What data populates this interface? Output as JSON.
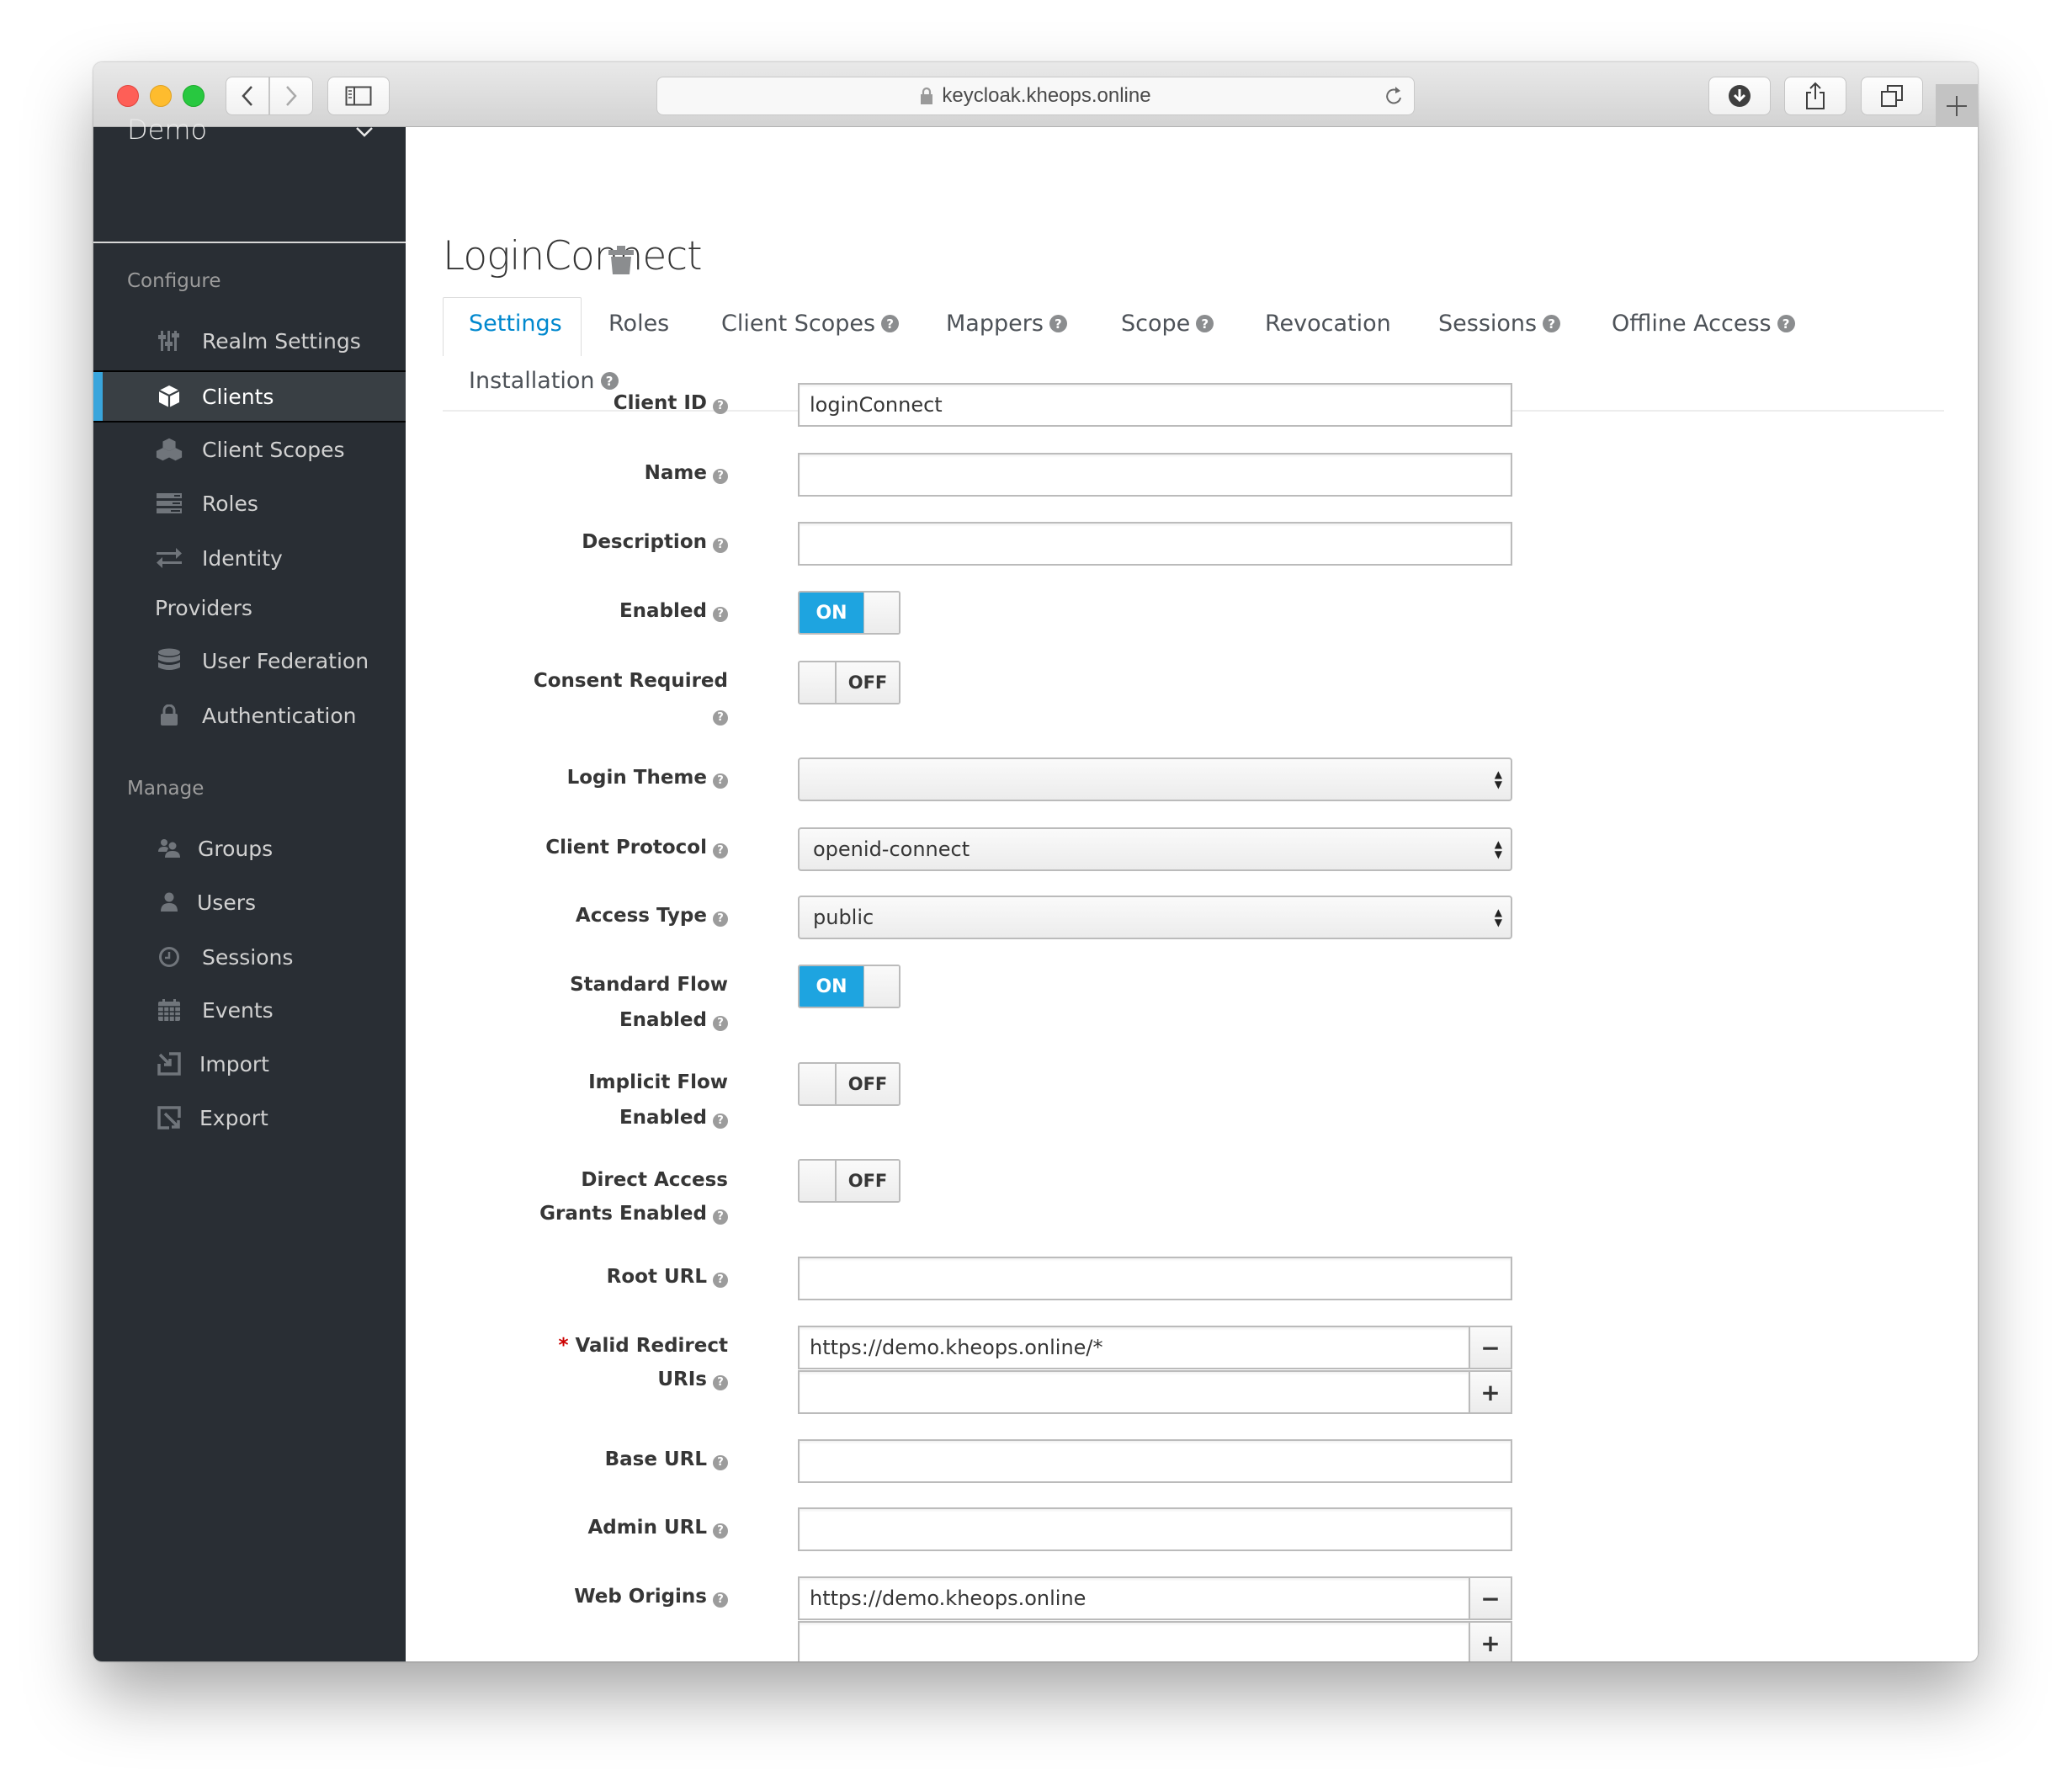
{
  "browser": {
    "url": "keycloak.kheops.online",
    "traffic_lights": {
      "close": "#fe5f57",
      "minimize": "#febc2e",
      "zoom": "#28c840"
    },
    "icons": [
      "back-icon",
      "forward-icon",
      "sidebar-toggle-icon",
      "lock-icon",
      "reload-icon",
      "download-icon",
      "share-icon",
      "tabs-overview-icon",
      "new-tab-icon"
    ]
  },
  "sidebar": {
    "realm": "Demo",
    "sections": [
      {
        "label": "Configure"
      },
      {
        "label": "Manage"
      }
    ],
    "items": [
      {
        "label": "Realm Settings",
        "icon": "sliders-icon"
      },
      {
        "label": "Clients",
        "icon": "cube-icon",
        "active": true
      },
      {
        "label": "Client Scopes",
        "icon": "cubes-icon"
      },
      {
        "label": "Roles",
        "icon": "list-icon"
      },
      {
        "label": "Identity",
        "icon": "exchange-icon"
      },
      {
        "label": "Providers"
      },
      {
        "label": "User Federation",
        "icon": "database-icon"
      },
      {
        "label": "Authentication",
        "icon": "lock-icon"
      },
      {
        "label": "Groups",
        "icon": "users-icon"
      },
      {
        "label": "Users",
        "icon": "user-icon"
      },
      {
        "label": "Sessions",
        "icon": "clock-icon"
      },
      {
        "label": "Events",
        "icon": "calendar-icon"
      },
      {
        "label": "Import",
        "icon": "import-icon"
      },
      {
        "label": "Export",
        "icon": "export-icon"
      }
    ],
    "accent": "#39a5dc"
  },
  "main": {
    "title": "LoginConnect",
    "tabs": [
      {
        "label": "Settings",
        "active": true,
        "help": false
      },
      {
        "label": "Roles",
        "help": false
      },
      {
        "label": "Client Scopes",
        "help": true
      },
      {
        "label": "Mappers",
        "help": true
      },
      {
        "label": "Scope",
        "help": true
      },
      {
        "label": "Revocation",
        "help": false
      },
      {
        "label": "Sessions",
        "help": true
      },
      {
        "label": "Offline Access",
        "help": true
      },
      {
        "label": "Installation",
        "help": true
      }
    ],
    "help_glyph": "?",
    "form": {
      "client_id": {
        "label": "Client ID",
        "value": "loginConnect"
      },
      "name": {
        "label": "Name",
        "value": ""
      },
      "description": {
        "label": "Description",
        "value": ""
      },
      "enabled": {
        "label": "Enabled",
        "state": "ON"
      },
      "consent_required": {
        "label": "Consent Required",
        "state": "OFF"
      },
      "login_theme": {
        "label": "Login Theme",
        "value": ""
      },
      "client_protocol": {
        "label": "Client Protocol",
        "value": "openid-connect"
      },
      "access_type": {
        "label": "Access Type",
        "value": "public"
      },
      "standard_flow": {
        "label_line1": "Standard Flow",
        "label_line2": "Enabled",
        "state": "ON"
      },
      "implicit_flow": {
        "label_line1": "Implicit Flow",
        "label_line2": "Enabled",
        "state": "OFF"
      },
      "direct_access": {
        "label_line1": "Direct Access",
        "label_line2": "Grants Enabled",
        "state": "OFF"
      },
      "root_url": {
        "label": "Root URL",
        "value": ""
      },
      "valid_redirect_uris": {
        "required_mark": "*",
        "label_line1": "Valid Redirect",
        "label_line2": "URIs",
        "values": [
          "https://demo.kheops.online/*",
          ""
        ]
      },
      "base_url": {
        "label": "Base URL",
        "value": ""
      },
      "admin_url": {
        "label": "Admin URL",
        "value": ""
      },
      "web_origins": {
        "label": "Web Origins",
        "values": [
          "https://demo.kheops.online",
          ""
        ]
      },
      "remove_glyph": "−",
      "add_glyph": "+"
    },
    "toggle_on_color": "#1ea4e0",
    "active_tab_color": "#0088ce"
  }
}
